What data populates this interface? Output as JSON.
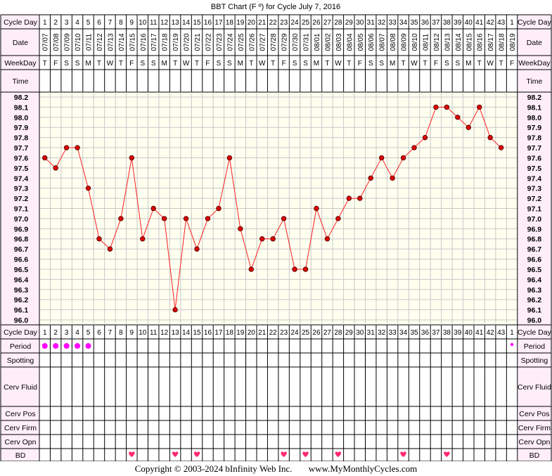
{
  "chart_data": {
    "type": "line",
    "title": "BBT Chart (F º) for Cycle July 7, 2016",
    "unit": "F",
    "cycle_days": [
      1,
      2,
      3,
      4,
      5,
      6,
      7,
      8,
      9,
      10,
      11,
      12,
      13,
      14,
      15,
      16,
      17,
      18,
      19,
      20,
      21,
      22,
      23,
      24,
      25,
      26,
      27,
      28,
      29,
      30,
      31,
      32,
      33,
      34,
      35,
      36,
      37,
      38,
      39,
      40,
      41,
      42,
      43,
      1
    ],
    "dates": [
      "07/07",
      "07/08",
      "07/09",
      "07/10",
      "07/11",
      "07/12",
      "07/13",
      "07/14",
      "07/15",
      "07/16",
      "07/17",
      "07/18",
      "07/19",
      "07/20",
      "07/21",
      "07/22",
      "07/23",
      "07/24",
      "07/25",
      "07/26",
      "07/27",
      "07/28",
      "07/29",
      "07/30",
      "07/31",
      "08/01",
      "08/02",
      "08/03",
      "08/04",
      "08/05",
      "08/06",
      "08/07",
      "08/08",
      "08/09",
      "08/10",
      "08/11",
      "08/12",
      "08/13",
      "08/14",
      "08/15",
      "08/16",
      "08/17",
      "08/18",
      "08/19"
    ],
    "weekdays": [
      "T",
      "F",
      "S",
      "S",
      "M",
      "T",
      "W",
      "T",
      "F",
      "S",
      "S",
      "M",
      "T",
      "W",
      "T",
      "F",
      "S",
      "S",
      "M",
      "T",
      "W",
      "T",
      "F",
      "S",
      "S",
      "M",
      "T",
      "W",
      "T",
      "F",
      "S",
      "S",
      "M",
      "T",
      "W",
      "T",
      "F",
      "S",
      "S",
      "M",
      "T",
      "W",
      "T",
      "F"
    ],
    "temperatures": [
      97.6,
      97.5,
      97.7,
      97.7,
      97.3,
      96.8,
      96.7,
      97.0,
      97.6,
      96.8,
      97.1,
      97.0,
      96.1,
      97.0,
      96.7,
      97.0,
      97.1,
      97.6,
      96.9,
      96.5,
      96.8,
      96.8,
      97.0,
      96.5,
      96.5,
      97.1,
      96.8,
      97.0,
      97.2,
      97.2,
      97.4,
      97.6,
      97.4,
      97.6,
      97.7,
      97.8,
      98.1,
      98.1,
      98.0,
      97.9,
      98.1,
      97.8,
      97.7,
      null
    ],
    "y_ticks": [
      "98.2",
      "98.1",
      "98.0",
      "97.9",
      "97.8",
      "97.7",
      "97.6",
      "97.5",
      "97.4",
      "97.3",
      "97.2",
      "97.1",
      "97.0",
      "96.9",
      "96.8",
      "96.7",
      "96.6",
      "96.5",
      "96.4",
      "96.3",
      "96.2",
      "96.1",
      "96.0"
    ],
    "ylim": [
      96.0,
      98.2
    ],
    "grid": true,
    "period_days": [
      1,
      2,
      3,
      4,
      5
    ],
    "period_light_days": [
      44
    ],
    "bd_days": [
      9,
      13,
      15,
      23,
      25,
      28,
      34,
      38
    ],
    "colors": {
      "line": "#ff2020",
      "point": "#dd0000",
      "plot_bg": "#fffff0",
      "grid": "#c8c8c8",
      "label_bg": "#ffeefa",
      "period": "#ff00ff",
      "heart": "#ff2a6d"
    }
  },
  "labels": {
    "cycle_day": "Cycle Day",
    "date": "Date",
    "weekday": "WeekDay",
    "time": "Time",
    "period": "Period",
    "spotting": "Spotting",
    "cerv_fluid": "Cerv Fluid",
    "cerv_pos": "Cerv Pos",
    "cerv_firm": "Cerv Firm",
    "cerv_opn": "Cerv Opn",
    "bd": "BD"
  },
  "footer": {
    "copyright": "Copyright © 2003-2024 bInfinity Web Inc.",
    "site": "www.MyMonthlyCycles.com"
  }
}
